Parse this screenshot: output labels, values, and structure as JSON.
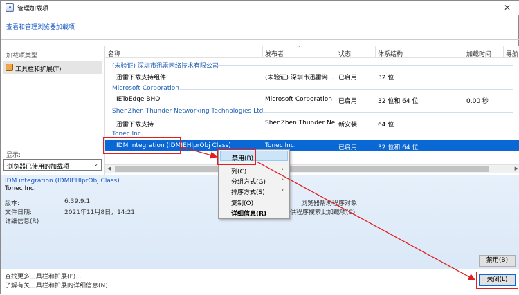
{
  "window": {
    "title": "管理加载项"
  },
  "top_link": "查看和管理浏览器加载项",
  "left": {
    "section_label": "加载项类型",
    "item": "工具栏和扩展(T)",
    "show_label": "显示:",
    "show_value": "浏览器已使用的加载项"
  },
  "table": {
    "headers": [
      "名称",
      "发布者",
      "状态",
      "体系结构",
      "加载时间",
      "导航"
    ],
    "groups": [
      {
        "name": "(未验证) 深圳市迅雷网络技术有限公司",
        "rows": [
          [
            "迅雷下载支持组件",
            "(未验证) 深圳市迅雷网...",
            "已启用",
            "32 位",
            ""
          ]
        ]
      },
      {
        "name": "Microsoft Corporation",
        "rows": [
          [
            "IEToEdge BHO",
            "Microsoft Corporation",
            "已启用",
            "32 位和 64 位",
            "0.00 秒"
          ]
        ]
      },
      {
        "name": "ShenZhen Thunder Networking Technologies Ltd.",
        "rows": [
          [
            "迅雷下载支持",
            "ShenZhen Thunder Ne...",
            "新安装",
            "64 位",
            ""
          ]
        ]
      },
      {
        "name": "Tonec Inc.",
        "rows": [
          [
            "IDM integration (IDMIEHlprObj Class)",
            "Tonec Inc.",
            "已启用",
            "32 位和 64 位",
            ""
          ]
        ]
      }
    ]
  },
  "context_menu": [
    {
      "label": "禁用(B)",
      "bold": false,
      "submenu": false
    },
    {
      "label": "列(C)",
      "bold": false,
      "submenu": true
    },
    {
      "label": "分组方式(G)",
      "bold": false,
      "submenu": true
    },
    {
      "label": "排序方式(S)",
      "bold": false,
      "submenu": true
    },
    {
      "label": "复制(O)",
      "bold": false,
      "submenu": false
    },
    {
      "label": "详细信息(R)",
      "bold": true,
      "submenu": false
    }
  ],
  "details": {
    "title": "IDM integration (IDMIEHlprObj Class)",
    "publisher": "Tonec Inc.",
    "version_label": "版本:",
    "version": "6.39.9.1",
    "date_label": "文件日期:",
    "date": "2021年11月8日，14:21",
    "more_info": "详细信息(R)",
    "type_label": "浏览器帮助程序对象",
    "search_link": "供程序搜索此加载项(C)"
  },
  "buttons": {
    "disable": "禁用(B)",
    "close": "关闭(L)"
  },
  "bottom_links": [
    "查找更多工具栏和扩展(F)...",
    "了解有关工具栏和扩展的详细信息(N)"
  ],
  "colors": {
    "accent": "#0a67d6",
    "link": "#1a59c9",
    "annotation": "#e02020"
  }
}
